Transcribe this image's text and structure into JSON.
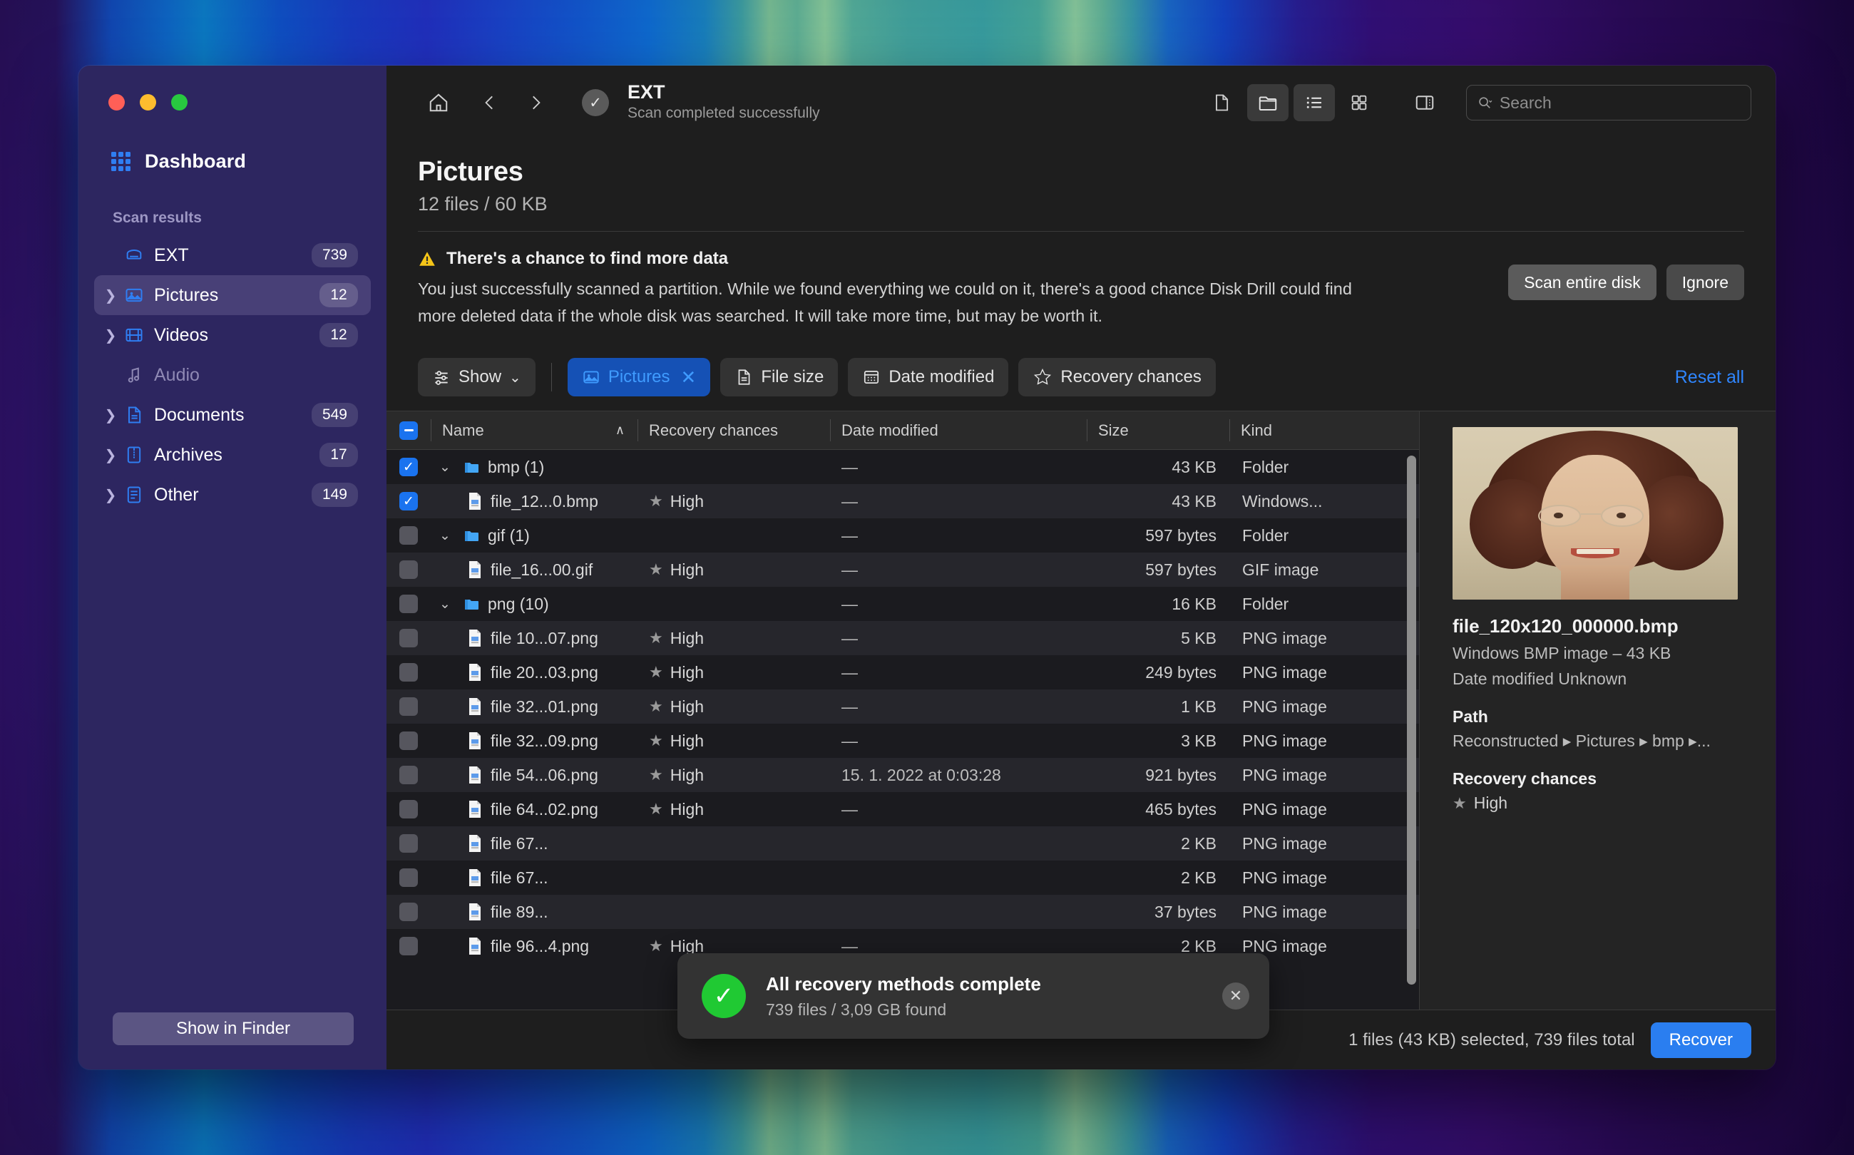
{
  "sidebar": {
    "dashboard_label": "Dashboard",
    "section_label": "Scan results",
    "items": [
      {
        "label": "EXT",
        "badge": "739",
        "icon": "disk-icon",
        "expandable": false,
        "active": false,
        "muted": false
      },
      {
        "label": "Pictures",
        "badge": "12",
        "icon": "picture-icon",
        "expandable": true,
        "active": true,
        "muted": false
      },
      {
        "label": "Videos",
        "badge": "12",
        "icon": "video-icon",
        "expandable": true,
        "active": false,
        "muted": false
      },
      {
        "label": "Audio",
        "badge": "",
        "icon": "music-icon",
        "expandable": false,
        "active": false,
        "muted": true
      },
      {
        "label": "Documents",
        "badge": "549",
        "icon": "document-icon",
        "expandable": true,
        "active": false,
        "muted": false
      },
      {
        "label": "Archives",
        "badge": "17",
        "icon": "archive-icon",
        "expandable": true,
        "active": false,
        "muted": false
      },
      {
        "label": "Other",
        "badge": "149",
        "icon": "other-icon",
        "expandable": true,
        "active": false,
        "muted": false
      }
    ],
    "show_in_finder_label": "Show in Finder"
  },
  "toolbar": {
    "home_icon": "home-icon",
    "back_icon": "chevron-left-icon",
    "forward_icon": "chevron-right-icon",
    "status_icon": "check-circle-icon",
    "title": "EXT",
    "subtitle": "Scan completed successfully",
    "view_icons": [
      "file-icon",
      "folder-icon",
      "list-icon",
      "grid-icon",
      "sidebar-icon"
    ],
    "search_placeholder": "Search",
    "search_value": ""
  },
  "page": {
    "title": "Pictures",
    "subtitle": "12 files / 60 KB"
  },
  "banner": {
    "warning_icon": "warning-triangle-icon",
    "title": "There's a chance to find more data",
    "body": "You just successfully scanned a partition. While we found everything we could on it, there's a good chance Disk Drill could find more deleted data if the whole disk was searched. It will take more time, but may be worth it.",
    "primary_label": "Scan entire disk",
    "secondary_label": "Ignore"
  },
  "filters": {
    "show_label": "Show",
    "chips": [
      {
        "label": "Pictures",
        "icon": "picture-icon",
        "active": true,
        "removable": true
      },
      {
        "label": "File size",
        "icon": "document-icon",
        "active": false,
        "removable": false
      },
      {
        "label": "Date modified",
        "icon": "calendar-icon",
        "active": false,
        "removable": false
      },
      {
        "label": "Recovery chances",
        "icon": "star-icon",
        "active": false,
        "removable": false
      }
    ],
    "reset_label": "Reset all"
  },
  "table": {
    "columns": [
      "Name",
      "Recovery chances",
      "Date modified",
      "Size",
      "Kind"
    ],
    "sort_column": "Name",
    "sort_direction": "asc",
    "header_checkbox_state": "mixed",
    "rows": [
      {
        "name": "bmp (1)",
        "recovery": "",
        "date": "—",
        "size": "43 KB",
        "kind": "Folder",
        "checked": true,
        "type": "folder",
        "depth": 1,
        "expanded": true
      },
      {
        "name": "file_12...0.bmp",
        "recovery": "High",
        "date": "—",
        "size": "43 KB",
        "kind": "Windows...",
        "checked": true,
        "type": "file",
        "depth": 2,
        "expanded": false
      },
      {
        "name": "gif (1)",
        "recovery": "",
        "date": "—",
        "size": "597 bytes",
        "kind": "Folder",
        "checked": false,
        "type": "folder",
        "depth": 1,
        "expanded": true
      },
      {
        "name": "file_16...00.gif",
        "recovery": "High",
        "date": "—",
        "size": "597 bytes",
        "kind": "GIF image",
        "checked": false,
        "type": "file",
        "depth": 2,
        "expanded": false
      },
      {
        "name": "png (10)",
        "recovery": "",
        "date": "—",
        "size": "16 KB",
        "kind": "Folder",
        "checked": false,
        "type": "folder",
        "depth": 1,
        "expanded": true
      },
      {
        "name": "file 10...07.png",
        "recovery": "High",
        "date": "—",
        "size": "5 KB",
        "kind": "PNG image",
        "checked": false,
        "type": "file",
        "depth": 2,
        "expanded": false
      },
      {
        "name": "file 20...03.png",
        "recovery": "High",
        "date": "—",
        "size": "249 bytes",
        "kind": "PNG image",
        "checked": false,
        "type": "file",
        "depth": 2,
        "expanded": false
      },
      {
        "name": "file 32...01.png",
        "recovery": "High",
        "date": "—",
        "size": "1 KB",
        "kind": "PNG image",
        "checked": false,
        "type": "file",
        "depth": 2,
        "expanded": false
      },
      {
        "name": "file 32...09.png",
        "recovery": "High",
        "date": "—",
        "size": "3 KB",
        "kind": "PNG image",
        "checked": false,
        "type": "file",
        "depth": 2,
        "expanded": false
      },
      {
        "name": "file 54...06.png",
        "recovery": "High",
        "date": "15. 1. 2022 at 0:03:28",
        "size": "921 bytes",
        "kind": "PNG image",
        "checked": false,
        "type": "file",
        "depth": 2,
        "expanded": false
      },
      {
        "name": "file 64...02.png",
        "recovery": "High",
        "date": "—",
        "size": "465 bytes",
        "kind": "PNG image",
        "checked": false,
        "type": "file",
        "depth": 2,
        "expanded": false
      },
      {
        "name": "file 67...",
        "recovery": "",
        "date": "",
        "size": "2 KB",
        "kind": "PNG image",
        "checked": false,
        "type": "file",
        "depth": 2,
        "expanded": false
      },
      {
        "name": "file 67...",
        "recovery": "",
        "date": "",
        "size": "2 KB",
        "kind": "PNG image",
        "checked": false,
        "type": "file",
        "depth": 2,
        "expanded": false
      },
      {
        "name": "file 89...",
        "recovery": "",
        "date": "",
        "size": "37 bytes",
        "kind": "PNG image",
        "checked": false,
        "type": "file",
        "depth": 2,
        "expanded": false
      },
      {
        "name": "file 96...4.png",
        "recovery": "High",
        "date": "—",
        "size": "2 KB",
        "kind": "PNG image",
        "checked": false,
        "type": "file",
        "depth": 2,
        "expanded": false
      }
    ]
  },
  "preview": {
    "thumbnail_alt": "portrait-photo",
    "file_name": "file_120x120_000000.bmp",
    "file_meta": "Windows BMP image – 43 KB",
    "date_modified": "Date modified Unknown",
    "path_heading": "Path",
    "path_value": "Reconstructed ▸ Pictures ▸ bmp ▸...",
    "recovery_heading": "Recovery chances",
    "recovery_value": "High"
  },
  "toast": {
    "icon": "success-check-icon",
    "title": "All recovery methods complete",
    "subtitle": "739 files / 3,09 GB found",
    "close_icon": "close-icon"
  },
  "statusbar": {
    "summary": "1 files (43 KB) selected, 739 files total",
    "recover_label": "Recover"
  },
  "colors": {
    "accent_blue": "#2a7ef0",
    "sidebar_bg": "#2d2660",
    "success_green": "#20c933",
    "warning_yellow": "#f5c518"
  }
}
